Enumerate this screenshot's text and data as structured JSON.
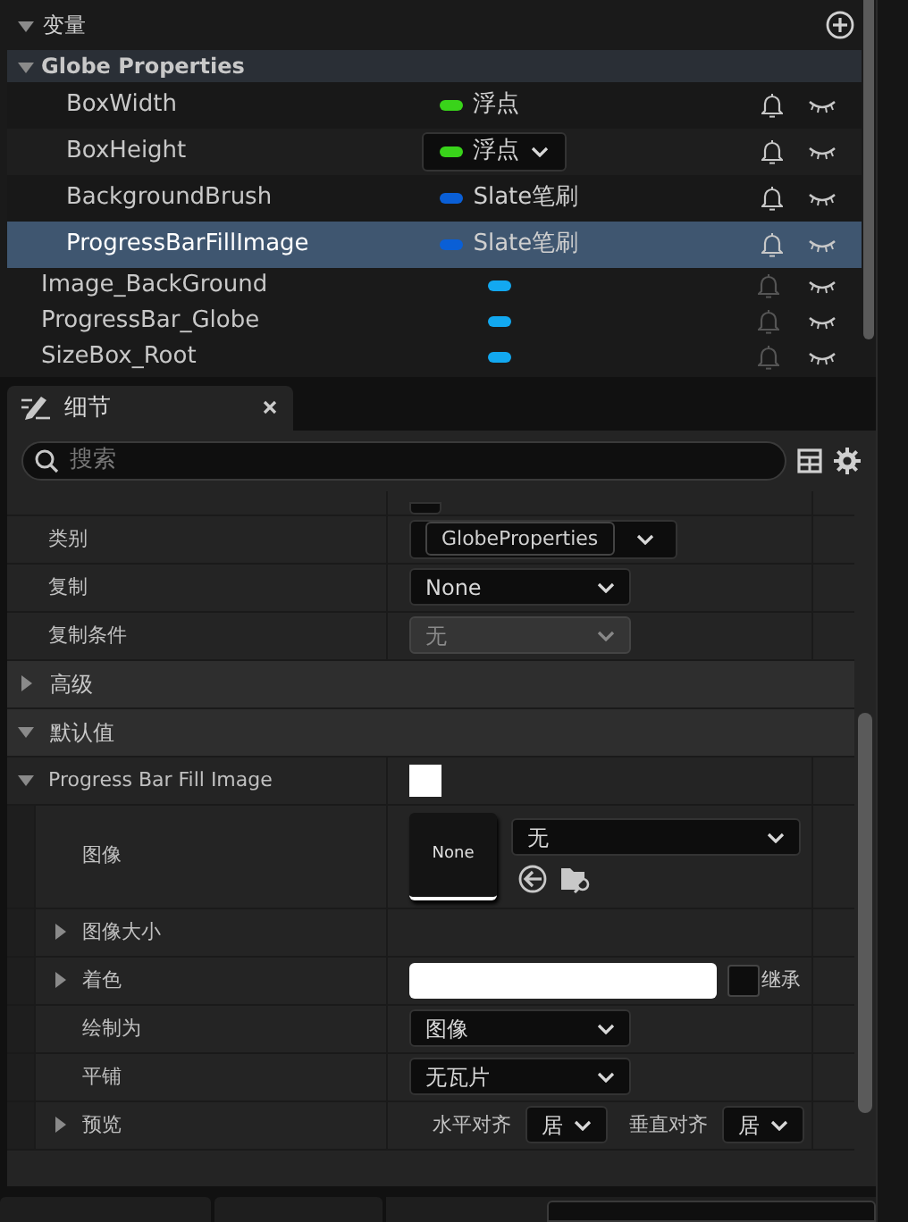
{
  "variables": {
    "header": "变量",
    "category": {
      "label": "Globe Properties",
      "expanded": true,
      "items": [
        {
          "name": "BoxWidth",
          "type": "浮点",
          "color": "#39d31a",
          "selected": false,
          "editing": false
        },
        {
          "name": "BoxHeight",
          "type": "浮点",
          "color": "#39d31a",
          "selected": false,
          "editing": true
        },
        {
          "name": "BackgroundBrush",
          "type": "Slate笔刷",
          "color": "#0a5fd6",
          "selected": false,
          "editing": false
        },
        {
          "name": "ProgressBarFillImage",
          "type": "Slate笔刷",
          "color": "#0a5fd6",
          "selected": true,
          "editing": false
        }
      ]
    },
    "widgets": [
      {
        "name": "Image_BackGround",
        "color": "#12a8f0"
      },
      {
        "name": "ProgressBar_Globe",
        "color": "#12a8f0"
      },
      {
        "name": "SizeBox_Root",
        "color": "#12a8f0"
      }
    ]
  },
  "details": {
    "tab": "细节",
    "search": {
      "placeholder": "搜索"
    },
    "rows": [
      {
        "kind": "partial"
      },
      {
        "kind": "combo",
        "label": "类别",
        "value": "GlobeProperties"
      },
      {
        "kind": "dropdown",
        "label": "复制",
        "value": "None",
        "disabled": false
      },
      {
        "kind": "dropdown",
        "label": "复制条件",
        "value": "无",
        "disabled": true
      },
      {
        "kind": "section",
        "label": "高级",
        "expanded": false
      },
      {
        "kind": "section",
        "label": "默认值",
        "expanded": true
      },
      {
        "kind": "struct",
        "label": "Progress Bar Fill Image",
        "expanded": true,
        "children": [
          {
            "kind": "image",
            "label": "图像",
            "thumb": "None",
            "value": "无"
          },
          {
            "kind": "group",
            "label": "图像大小",
            "expanded": false
          },
          {
            "kind": "tint",
            "label": "着色",
            "expanded": false,
            "inherit": "继承",
            "checked": false
          },
          {
            "kind": "dropdown",
            "label": "绘制为",
            "value": "图像",
            "disabled": false
          },
          {
            "kind": "dropdown",
            "label": "平铺",
            "value": "无瓦片",
            "disabled": false
          },
          {
            "kind": "align",
            "label": "预览",
            "expanded": false,
            "h_label": "水平对齐",
            "h_value": "居",
            "v_label": "垂直对齐",
            "v_value": "居"
          }
        ]
      }
    ]
  }
}
